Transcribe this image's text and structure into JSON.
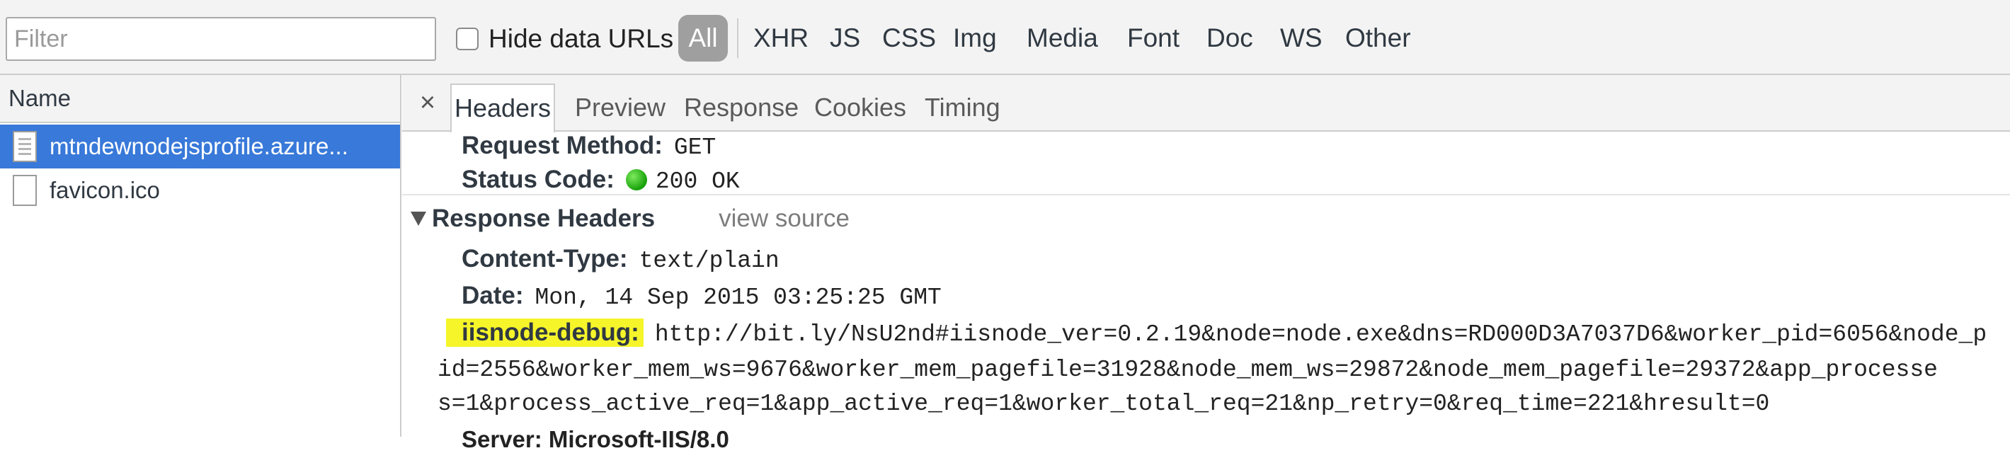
{
  "toolbar": {
    "filter_placeholder": "Filter",
    "hide_data_urls_label": "Hide data URLs",
    "hide_data_urls_checked": false,
    "filters": [
      "All",
      "XHR",
      "JS",
      "CSS",
      "Img",
      "Media",
      "Font",
      "Doc",
      "WS",
      "Other"
    ],
    "active_filter": "All"
  },
  "requests": {
    "column_header": "Name",
    "items": [
      {
        "name": "mtndewnodejsprofile.azure...",
        "icon": "document-icon",
        "selected": true
      },
      {
        "name": "favicon.ico",
        "icon": "file-icon",
        "selected": false
      }
    ]
  },
  "details": {
    "close_label": "×",
    "tabs": [
      "Headers",
      "Preview",
      "Response",
      "Cookies",
      "Timing"
    ],
    "active_tab": "Headers",
    "general": {
      "request_method_key": "Request Method:",
      "request_method_val": "GET",
      "status_code_key": "Status Code:",
      "status_code_val": "200 OK"
    },
    "response_headers": {
      "title": "Response Headers",
      "view_source": "view source",
      "content_type_key": "Content-Type:",
      "content_type_val": "text/plain",
      "date_key": "Date:",
      "date_val": "Mon, 14 Sep 2015 03:25:25 GMT",
      "iisnode_key": "iisnode-debug:",
      "iisnode_line1": "http://bit.ly/NsU2nd#iisnode_ver=0.2.19&node=node.exe&dns=RD000D3A7037D6&worker_pid=6056&node_p",
      "iisnode_line2": "id=2556&worker_mem_ws=9676&worker_mem_pagefile=31928&node_mem_ws=29872&node_mem_pagefile=29372&app_processe",
      "iisnode_line3": "s=1&process_active_req=1&app_active_req=1&worker_total_req=21&np_retry=0&req_time=221&hresult=0",
      "server_partial": "Server: Microsoft-IIS/8.0"
    },
    "colors": {
      "selected_row": "#3879d9",
      "highlight": "#f5f52a",
      "status_ok": "#16a10a"
    }
  }
}
